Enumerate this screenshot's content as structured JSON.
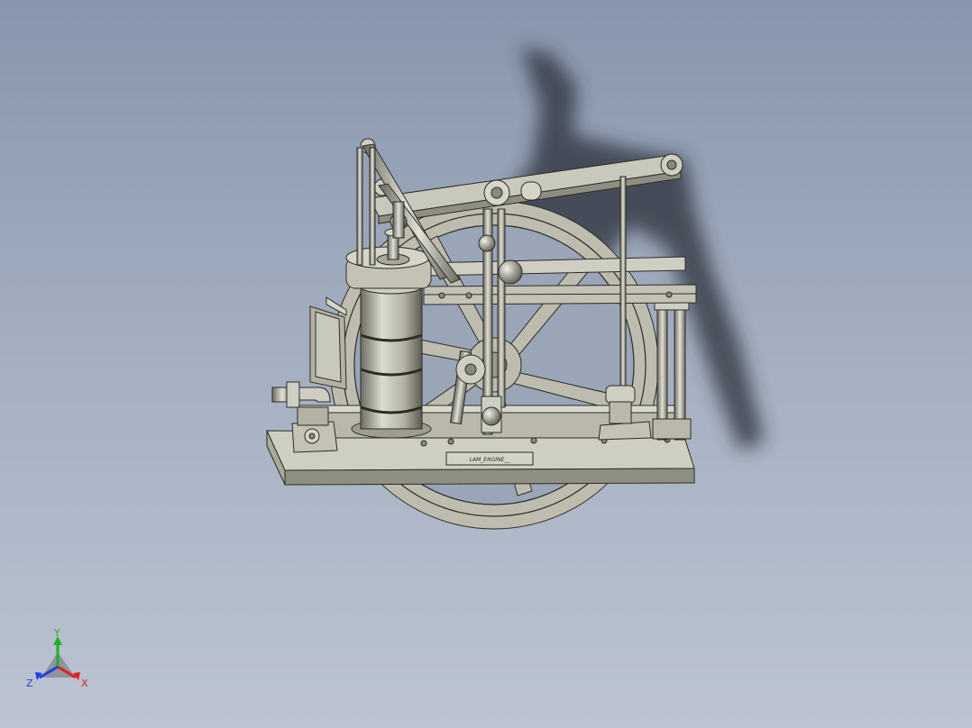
{
  "viewport": {
    "background_top": "#8796ad",
    "background_bottom": "#bcc4d2"
  },
  "model": {
    "material_color": "#bdbcae",
    "edge_color": "#2c2c26",
    "shadow_color": "#2a2f38",
    "nameplate_text": "LAM_ENGINE__"
  },
  "triad": {
    "x_label": "X",
    "y_label": "Y",
    "z_label": "Z",
    "x_color": "#e02020",
    "y_color": "#20b020",
    "z_color": "#2040e0"
  }
}
